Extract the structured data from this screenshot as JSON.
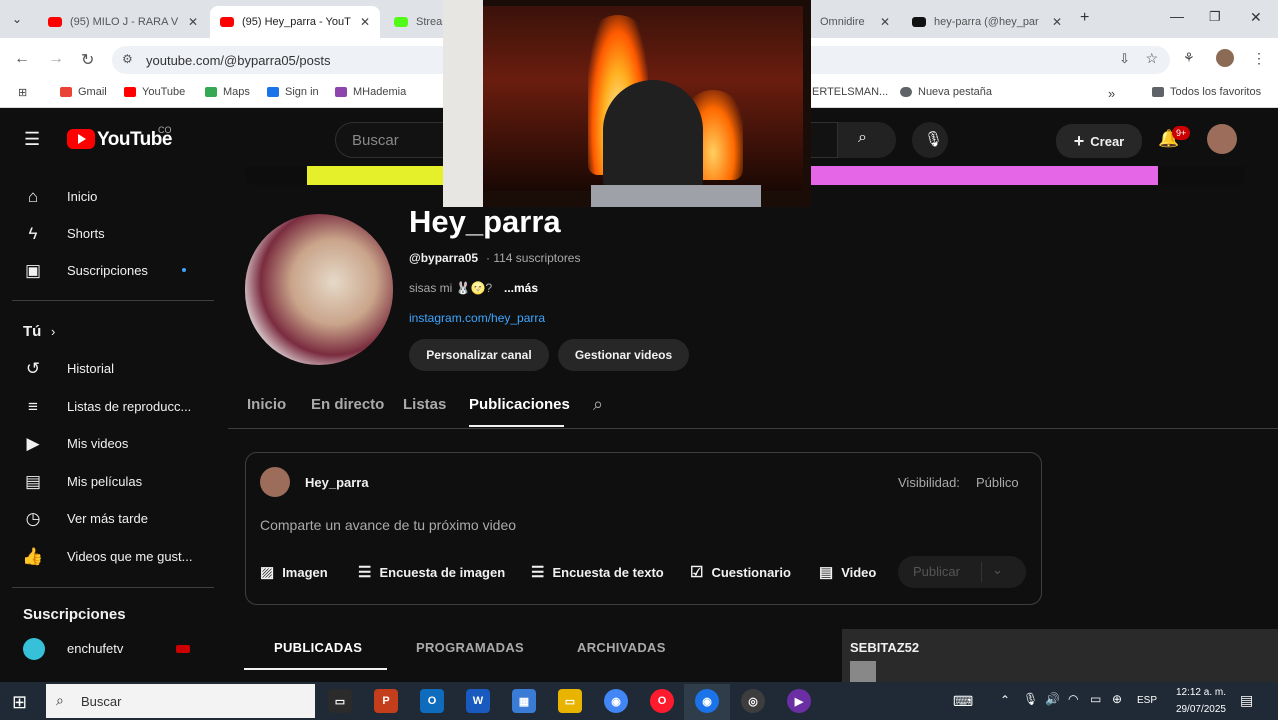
{
  "browser": {
    "tabs": [
      {
        "label": "(95) MILO J - RARA V",
        "color": "#ff0000"
      },
      {
        "label": "(95) Hey_parra - YouT",
        "color": "#ff0000"
      },
      {
        "label": "Strea",
        "color": "#53fc18"
      },
      {
        "label": "Omnidire",
        "color": "#888888"
      },
      {
        "label": "hey-parra (@hey_par",
        "color": "#111111"
      }
    ],
    "url": "youtube.com/@byparra05/posts",
    "bookmarks": [
      {
        "label": "Gmail",
        "color": "#ea4335"
      },
      {
        "label": "YouTube",
        "color": "#ff0000"
      },
      {
        "label": "Maps",
        "color": "#34a853"
      },
      {
        "label": "Sign in",
        "color": "#1a73e8"
      },
      {
        "label": "MHademia",
        "color": "#8e44ad"
      },
      {
        "label": "ERTELSMAN...",
        "color": "#cccccc"
      },
      {
        "label": "Nueva pestaña",
        "color": "#5f6368"
      },
      {
        "label": "Todos los favoritos",
        "color": "#5f6368"
      }
    ]
  },
  "yt": {
    "logo_text": "YouTube",
    "country": "CO",
    "search_placeholder": "Buscar",
    "create_label": "Crear",
    "notif_count": "9+",
    "sidebar": {
      "top": [
        {
          "label": "Inicio",
          "icon": "home-icon",
          "glyph": "⌂"
        },
        {
          "label": "Shorts",
          "icon": "shorts-icon",
          "glyph": "⚡"
        },
        {
          "label": "Suscripciones",
          "icon": "subscriptions-icon",
          "glyph": "▣"
        }
      ],
      "you_label": "Tú",
      "you": [
        {
          "label": "Historial",
          "icon": "history-icon",
          "glyph": "↺"
        },
        {
          "label": "Listas de reproducc...",
          "icon": "playlists-icon",
          "glyph": "≡"
        },
        {
          "label": "Mis videos",
          "icon": "your-videos-icon",
          "glyph": "▶"
        },
        {
          "label": "Mis películas",
          "icon": "movies-icon",
          "glyph": "🎬"
        },
        {
          "label": "Ver más tarde",
          "icon": "watch-later-icon",
          "glyph": "◷"
        },
        {
          "label": "Videos que me gust...",
          "icon": "liked-icon",
          "glyph": "👍"
        }
      ],
      "subs_label": "Suscripciones",
      "subs": [
        {
          "label": "enchufetv"
        }
      ]
    },
    "channel": {
      "name": "Hey_parra",
      "handle": "@byparra05",
      "subs": "· 114 suscriptores",
      "desc": "sisas mi 🐰🌝?",
      "more": "...más",
      "link": "instagram.com/hey_parra",
      "btn_customize": "Personalizar canal",
      "btn_manage": "Gestionar videos",
      "tabs": [
        "Inicio",
        "En directo",
        "Listas",
        "Publicaciones"
      ]
    },
    "composer": {
      "author": "Hey_parra",
      "visibility_label": "Visibilidad:",
      "visibility_value": "Público",
      "placeholder": "Comparte un avance de tu próximo video",
      "actions": [
        {
          "label": "Imagen",
          "glyph": "▨"
        },
        {
          "label": "Encuesta de imagen",
          "glyph": "☰"
        },
        {
          "label": "Encuesta de texto",
          "glyph": "☰"
        },
        {
          "label": "Cuestionario",
          "glyph": "☑"
        },
        {
          "label": "Video",
          "glyph": "▤"
        }
      ],
      "publish": "Publicar"
    },
    "subtabs": [
      "PUBLICADAS",
      "PROGRAMADAS",
      "ARCHIVADAS"
    ]
  },
  "overlay": {
    "chat_user": "SEBITAZ52"
  },
  "taskbar": {
    "search": "Buscar",
    "lang": "ESP",
    "time": "12:12 a. m.",
    "date": "29/07/2025",
    "apps": [
      {
        "label": "C",
        "color": "#2b2b2b"
      },
      {
        "label": "P",
        "color": "#c43e1c"
      },
      {
        "label": "O",
        "color": "#0f6cbd"
      },
      {
        "label": "W",
        "color": "#185abd"
      },
      {
        "label": "▦",
        "color": "#3a7bd5"
      },
      {
        "label": "▭",
        "color": "#e8b400"
      },
      {
        "label": "◉",
        "color": "#4285f4"
      },
      {
        "label": "O",
        "color": "#ff1b2d"
      },
      {
        "label": "◉",
        "color": "#1a73e8"
      },
      {
        "label": "◎",
        "color": "#3d3d3d"
      },
      {
        "label": "▶",
        "color": "#6b2fa3"
      }
    ]
  }
}
